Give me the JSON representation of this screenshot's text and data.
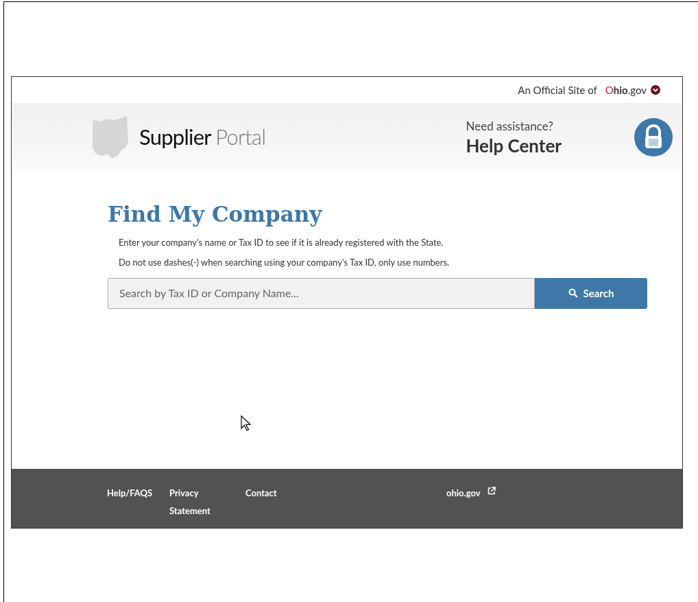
{
  "official_site": {
    "label": "An Official Site of",
    "logo": "O**hio**.gov"
  },
  "header": {
    "brand": "Supplier",
    "brand_light": "Portal",
    "assist_prompt": "Need assistance?",
    "help_link": "Help Center"
  },
  "main": {
    "title": "Find My Company",
    "instructions": [
      "Enter your company's name or Tax ID to see if it is already registered with the State.",
      "Do not use dashes(-) when searching using your company's Tax ID, only use numbers."
    ],
    "search": {
      "placeholder": "Search by Tax ID or Company Name...",
      "button": "Search"
    }
  },
  "footer": {
    "links": [
      {
        "label": "Help/FAQS",
        "external": false
      },
      {
        "label": "Privacy Statement",
        "external": false
      },
      {
        "label": "Contact",
        "external": false
      },
      {
        "label": "ohio.gov",
        "external": true
      }
    ]
  }
}
